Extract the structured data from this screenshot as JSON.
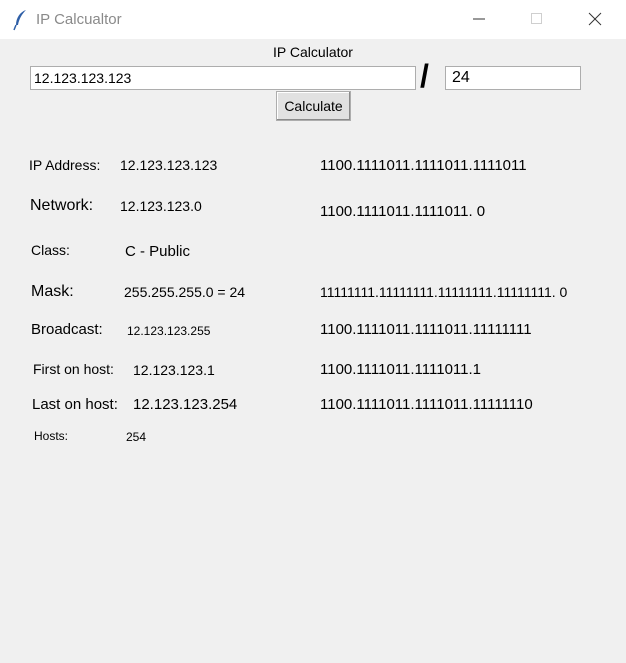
{
  "window": {
    "title": "IP Calcualtor",
    "icon": "feather-icon",
    "controls": [
      "minimize-icon",
      "maximize-icon",
      "close-icon"
    ]
  },
  "form": {
    "heading": "IP Calculator",
    "ip_value": "12.123.123.123",
    "separator": "/",
    "prefix_value": "24",
    "calculate_label": "Calculate"
  },
  "results": {
    "ip_address": {
      "label": "IP Address:",
      "value": "12.123.123.123",
      "binary": "1100.1111011.1111011.1111011"
    },
    "network": {
      "label": "Network:",
      "value": "12.123.123.0",
      "binary": "1100.1111011.1111011. 0"
    },
    "class": {
      "label": "Class:",
      "value": "C - Public"
    },
    "mask": {
      "label": "Mask:",
      "value": "255.255.255.0 = 24",
      "binary": "11111111.11111111.11111111.11111111. 0"
    },
    "broadcast": {
      "label": "Broadcast:",
      "value": "12.123.123.255",
      "binary": "1100.1111011.1111011.11111111"
    },
    "first_host": {
      "label": "First on host:",
      "value": "12.123.123.1",
      "binary": "1100.1111011.1111011.1"
    },
    "last_host": {
      "label": "Last on host:",
      "value": "12.123.123.254",
      "binary": "1100.1111011.1111011.11111110"
    },
    "hosts": {
      "label": "Hosts:",
      "value": "254"
    }
  }
}
